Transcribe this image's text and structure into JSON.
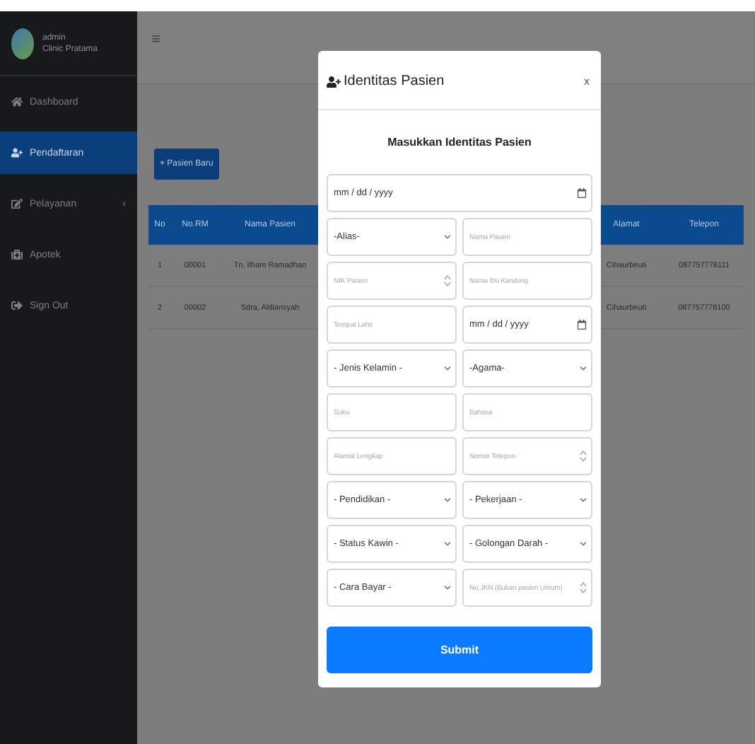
{
  "sidebar": {
    "user": "admin",
    "clinic": "Clinic Pratama",
    "items": [
      {
        "label": "Dashboard",
        "selected": false
      },
      {
        "label": "Pendaftaran",
        "selected": true
      },
      {
        "label": "Pelayanan",
        "selected": false,
        "caret": "‹"
      },
      {
        "label": "Apotek",
        "selected": false
      },
      {
        "label": "Sign Out",
        "selected": false
      }
    ]
  },
  "topbar": {
    "menu": "≡"
  },
  "new_button": "+ Pasien Baru",
  "table": {
    "columns": [
      "No",
      "No.RM",
      "Nama Pasien",
      "Alamat",
      "Telepon"
    ],
    "rows": [
      [
        "1",
        "00001",
        "Tn, Ilham Ramadhan",
        "Cihaurbeuti",
        "087757778111"
      ],
      [
        "2",
        "00002",
        "Sdra, Aldiansyah",
        "Cihaurbeuti",
        "087757778100"
      ]
    ]
  },
  "modal": {
    "title": "Identitas Pasien",
    "close": "x",
    "heading": "Masukkan Identitas Pasien",
    "date_field": {
      "value": "mm / dd / yyyy"
    },
    "fields": [
      {
        "kind": "select",
        "value": "-Alias-"
      },
      {
        "kind": "text",
        "placeholder": "Nama Pasien"
      },
      {
        "kind": "number",
        "placeholder": "NIK Pasien"
      },
      {
        "kind": "text",
        "placeholder": "Nama Ibu Kandung"
      },
      {
        "kind": "text",
        "placeholder": "Tempat Lahir"
      },
      {
        "kind": "date",
        "value": "mm / dd / yyyy"
      },
      {
        "kind": "select",
        "value": "- Jenis Kelamin -"
      },
      {
        "kind": "select",
        "value": "-Agama-"
      },
      {
        "kind": "text",
        "placeholder": "Suku"
      },
      {
        "kind": "text",
        "placeholder": "Bahasa"
      },
      {
        "kind": "text",
        "placeholder": "Alamat Lengkap"
      },
      {
        "kind": "number",
        "placeholder": "Nomor Telepon"
      },
      {
        "kind": "select",
        "value": "- Pendidikan -"
      },
      {
        "kind": "select",
        "value": "- Pekerjaan -"
      },
      {
        "kind": "select",
        "value": "- Status Kawin -"
      },
      {
        "kind": "select",
        "value": "- Golongan Darah -"
      },
      {
        "kind": "select",
        "value": "- Cara Bayar -"
      },
      {
        "kind": "number",
        "placeholder": "No.JKN (Bukan pasien Umum)"
      }
    ],
    "submit": "Submit"
  }
}
